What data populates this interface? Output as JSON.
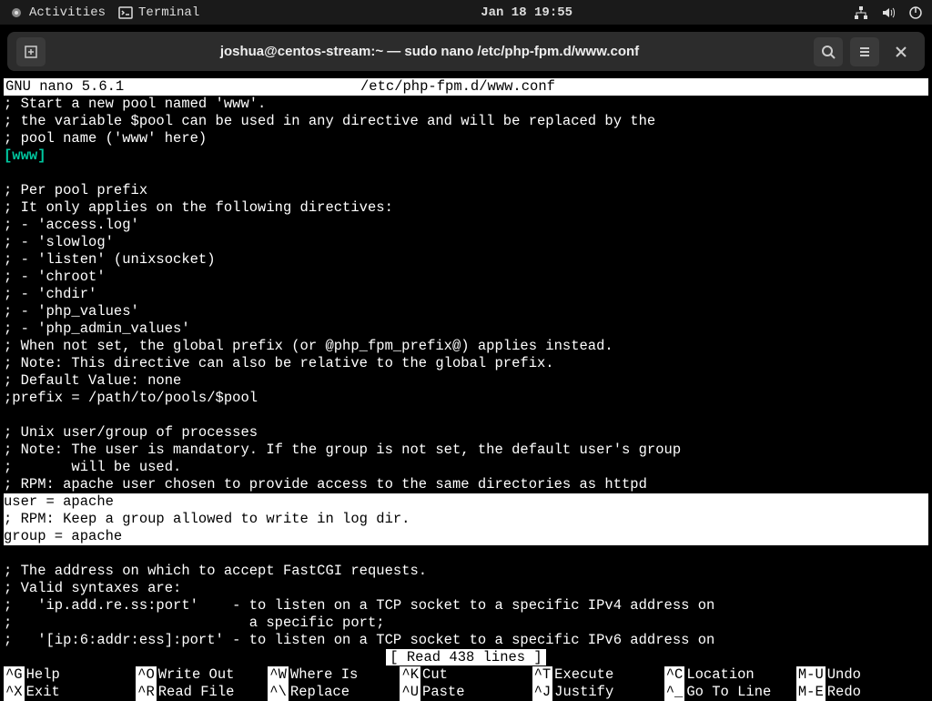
{
  "topbar": {
    "activities": "Activities",
    "terminal": "Terminal",
    "datetime": "Jan 18  19:55"
  },
  "window": {
    "title": "joshua@centos-stream:~ — sudo nano /etc/php-fpm.d/www.conf"
  },
  "nano": {
    "app": "GNU nano 5.6.1",
    "file": "/etc/php-fpm.d/www.conf",
    "section": "[www]",
    "status": "[ Read 438 lines ]",
    "lines_a": [
      "; Start a new pool named 'www'.",
      "; the variable $pool can be used in any directive and will be replaced by the",
      "; pool name ('www' here)"
    ],
    "lines_b": [
      "",
      "; Per pool prefix",
      "; It only applies on the following directives:",
      "; - 'access.log'",
      "; - 'slowlog'",
      "; - 'listen' (unixsocket)",
      "; - 'chroot'",
      "; - 'chdir'",
      "; - 'php_values'",
      "; - 'php_admin_values'",
      "; When not set, the global prefix (or @php_fpm_prefix@) applies instead.",
      "; Note: This directive can also be relative to the global prefix.",
      "; Default Value: none",
      ";prefix = /path/to/pools/$pool",
      "",
      "; Unix user/group of processes",
      "; Note: The user is mandatory. If the group is not set, the default user's group",
      ";       will be used.",
      "; RPM: apache user chosen to provide access to the same directories as httpd"
    ],
    "highlight": [
      "user = apache",
      "; RPM: Keep a group allowed to write in log dir.",
      "group = apache"
    ],
    "lines_c": [
      "",
      "; The address on which to accept FastCGI requests.",
      "; Valid syntaxes are:",
      ";   'ip.add.re.ss:port'    - to listen on a TCP socket to a specific IPv4 address on",
      ";                            a specific port;",
      ";   '[ip:6:addr:ess]:port' - to listen on a TCP socket to a specific IPv6 address on"
    ]
  },
  "shortcuts": [
    {
      "key": "^G",
      "label": "Help"
    },
    {
      "key": "^O",
      "label": "Write Out"
    },
    {
      "key": "^W",
      "label": "Where Is"
    },
    {
      "key": "^K",
      "label": "Cut"
    },
    {
      "key": "^T",
      "label": "Execute"
    },
    {
      "key": "^C",
      "label": "Location"
    },
    {
      "key": "M-U",
      "label": "Undo"
    },
    {
      "key": "^X",
      "label": "Exit"
    },
    {
      "key": "^R",
      "label": "Read File"
    },
    {
      "key": "^\\",
      "label": "Replace"
    },
    {
      "key": "^U",
      "label": "Paste"
    },
    {
      "key": "^J",
      "label": "Justify"
    },
    {
      "key": "^_",
      "label": "Go To Line"
    },
    {
      "key": "M-E",
      "label": "Redo"
    }
  ]
}
